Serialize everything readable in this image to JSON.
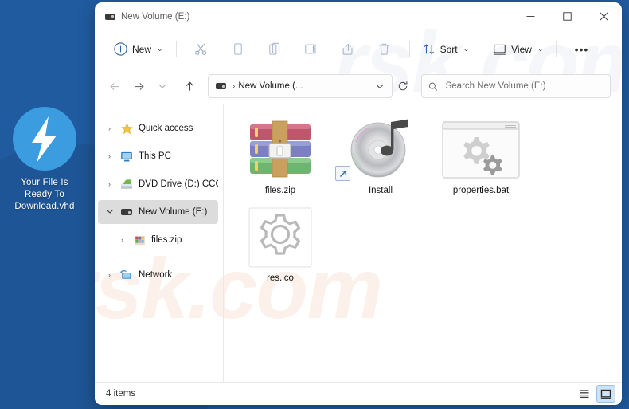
{
  "desktop": {
    "background_color": "#205ba0",
    "shortcut": {
      "icon": "lightning-bolt-icon",
      "icon_bg_color": "#3b9ce0",
      "label_line1": "Your File Is",
      "label_line2": "Ready To",
      "label_line3": "Download.vhd"
    },
    "watermark_text": "rsk.com"
  },
  "window": {
    "title": "New Volume (E:)",
    "title_icon": "drive-icon",
    "controls": {
      "minimize": "−",
      "maximize": "☐",
      "close": "✕"
    }
  },
  "toolbar": {
    "new_label": "New",
    "new_icon": "plus-circle-icon",
    "cut_icon": "scissors-icon",
    "copy_icon": "copy-icon",
    "paste_icon": "paste-icon",
    "rename_icon": "rename-icon",
    "share_icon": "share-icon",
    "delete_icon": "trash-icon",
    "sort_label": "Sort",
    "sort_icon": "sort-arrows-icon",
    "view_label": "View",
    "view_icon": "monitor-icon",
    "more_label": "•••",
    "chevron": "⌄"
  },
  "addressbar": {
    "back_icon": "arrow-left-icon",
    "forward_icon": "arrow-right-icon",
    "recent_icon": "chevron-down-icon",
    "up_icon": "arrow-up-icon",
    "drive_icon": "drive-icon",
    "crumb_separator": "›",
    "path_text": "New Volume (...",
    "dropdown_icon": "chevron-down-icon",
    "refresh_icon": "refresh-icon",
    "search_icon": "search-icon",
    "search_value": "",
    "search_placeholder": "Search New Volume (E:)"
  },
  "sidebar": {
    "items": [
      {
        "label": "Quick access",
        "icon": "star-icon",
        "expander": "›",
        "expanded": false,
        "selected": false,
        "indent": 0
      },
      {
        "label": "This PC",
        "icon": "monitor-icon",
        "expander": "›",
        "expanded": false,
        "selected": false,
        "indent": 0
      },
      {
        "label": "DVD Drive (D:) CCCC",
        "icon": "dvd-drive-icon",
        "expander": "›",
        "expanded": false,
        "selected": false,
        "indent": 0
      },
      {
        "label": "New Volume (E:)",
        "icon": "drive-icon",
        "expander": "⌄",
        "expanded": true,
        "selected": true,
        "indent": 0
      },
      {
        "label": "files.zip",
        "icon": "zip-archive-icon",
        "expander": "›",
        "expanded": false,
        "selected": false,
        "indent": 1
      },
      {
        "label": "Network",
        "icon": "network-icon",
        "expander": "›",
        "expanded": false,
        "selected": false,
        "indent": 0
      }
    ]
  },
  "files": [
    {
      "name": "files.zip",
      "icon": "winrar-archive-icon",
      "shortcut": false
    },
    {
      "name": "Install",
      "icon": "cd-audio-icon",
      "shortcut": true
    },
    {
      "name": "properties.bat",
      "icon": "bat-script-icon",
      "shortcut": false
    },
    {
      "name": "res.ico",
      "icon": "gear-ico-icon",
      "shortcut": false
    }
  ],
  "statusbar": {
    "item_count": "4 items",
    "view_list_icon": "list-view-icon",
    "view_tiles_icon": "tiles-view-icon",
    "active_view": "tiles"
  }
}
